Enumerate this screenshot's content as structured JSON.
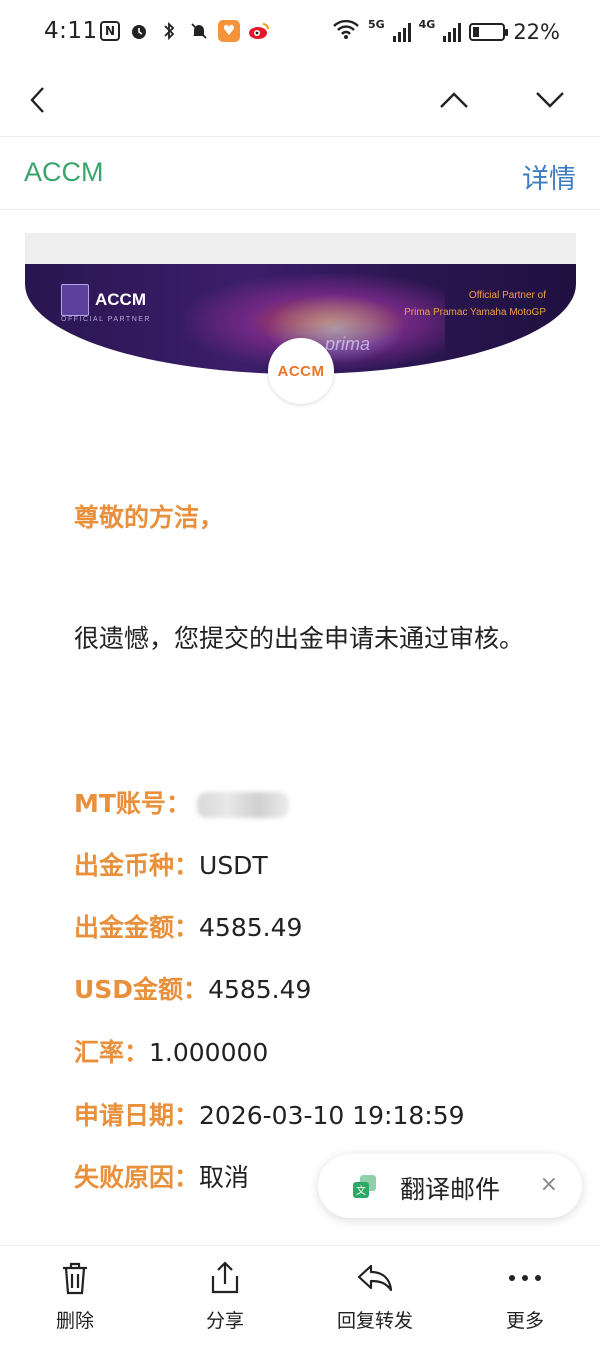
{
  "status_bar": {
    "time": "4:11",
    "network_5g": "5G",
    "network_4g": "4G",
    "battery": "22%",
    "battery_level": 0.22
  },
  "header": {
    "sender": "ACCM",
    "details_label": "详情"
  },
  "banner": {
    "brand": "ACCM",
    "official_partner": "OFFICIAL PARTNER",
    "partner_line1": "Official Partner of",
    "partner_line2": "Prima Pramac Yamaha MotoGP",
    "watermark": "prima",
    "logo_text": "ACCM"
  },
  "email": {
    "greeting": "尊敬的方洁，",
    "message": "很遗憾，您提交的出金申请未通过审核。",
    "fields": [
      {
        "key": "MT账号：",
        "value": ""
      },
      {
        "key": "出金币种：",
        "value": "USDT"
      },
      {
        "key": "出金金额：",
        "value": "4585.49"
      },
      {
        "key": "USD金额：",
        "value": "4585.49"
      },
      {
        "key": "汇率：",
        "value": "1.000000"
      },
      {
        "key": "申请日期：",
        "value": "2026-03-10 19:18:59"
      },
      {
        "key": "失败原因：",
        "value": "取消"
      }
    ]
  },
  "translate": {
    "label": "翻译邮件",
    "close": "×"
  },
  "bottom_bar": {
    "delete": "删除",
    "share": "分享",
    "reply_forward": "回复转发",
    "more": "更多"
  },
  "colors": {
    "accent_orange": "#e8903c",
    "sender_green": "#3aa56b",
    "link_blue": "#3b7dbf"
  }
}
